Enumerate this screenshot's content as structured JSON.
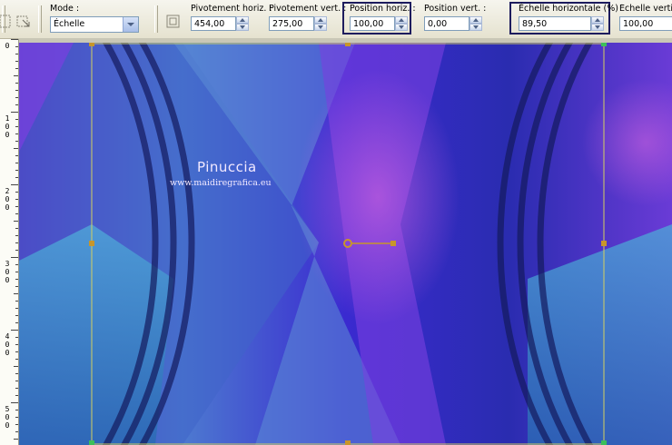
{
  "toolbar": {
    "mode": {
      "label": "Mode :",
      "value": "Échelle"
    },
    "pivot_h": {
      "label": "Pivotement horiz. :",
      "value": "454,00"
    },
    "pivot_v": {
      "label": "Pivotement vert. :",
      "value": "275,00"
    },
    "pos_h": {
      "label": "Position horiz. :",
      "value": "100,00"
    },
    "pos_v": {
      "label": "Position vert. :",
      "value": "0,00"
    },
    "scale_h": {
      "label": "Échelle horizontale (%)",
      "value": "89,50"
    },
    "scale_v": {
      "label": "Échelle vertical",
      "value": "100,00"
    }
  },
  "ruler": {
    "labels": [
      {
        "digits": [
          "0"
        ]
      },
      {
        "digits": [
          "1",
          "0",
          "0"
        ]
      },
      {
        "digits": [
          "2",
          "0",
          "0"
        ]
      },
      {
        "digits": [
          "3",
          "0",
          "0"
        ]
      },
      {
        "digits": [
          "4",
          "0",
          "0"
        ]
      },
      {
        "digits": [
          "5",
          "0",
          "0"
        ]
      }
    ]
  },
  "canvas": {
    "watermark_title": "Pinuccia",
    "watermark_url": "www.maidiregrafica.eu",
    "colors": {
      "deep": "#2b2fb8",
      "violet": "#8a45e0",
      "teal": "#3a8ec8",
      "magenta": "#c957d8",
      "handle": "#c8962a",
      "guide": "#d4d060"
    }
  }
}
